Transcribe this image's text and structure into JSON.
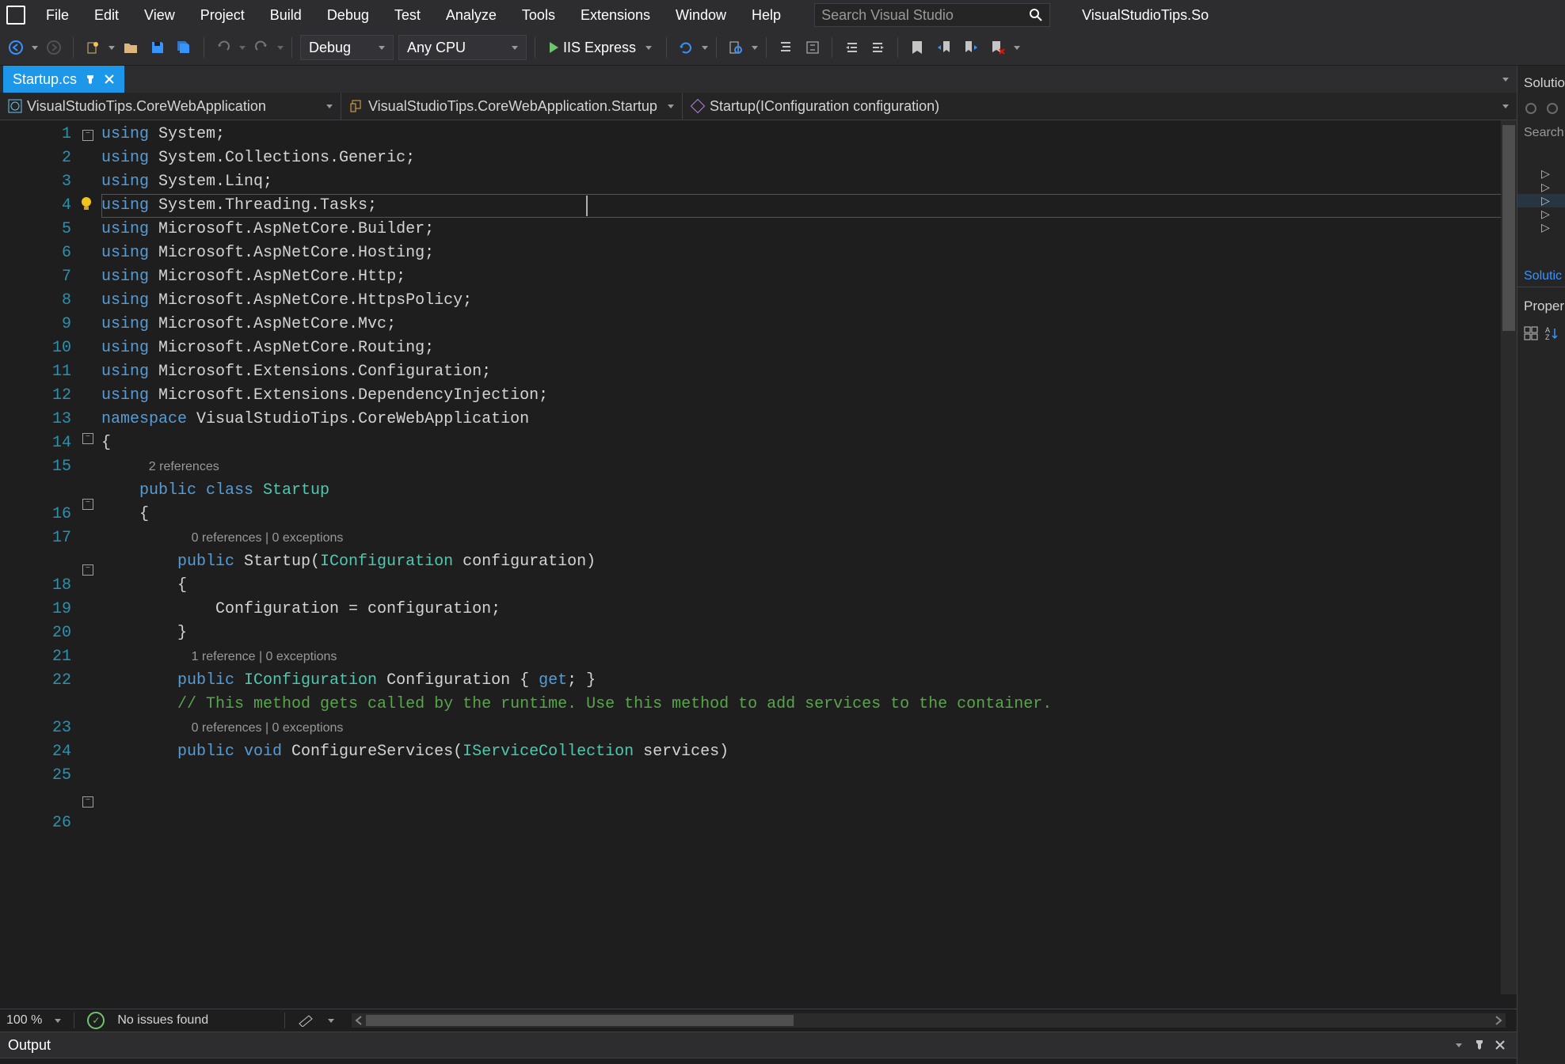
{
  "menu": {
    "items": [
      "File",
      "Edit",
      "View",
      "Project",
      "Build",
      "Debug",
      "Test",
      "Analyze",
      "Tools",
      "Extensions",
      "Window",
      "Help"
    ]
  },
  "search_placeholder": "Search Visual Studio",
  "solution_name": "VisualStudioTips.So",
  "toolbar": {
    "config": "Debug",
    "platform": "Any CPU",
    "run": "IIS Express"
  },
  "tab": {
    "name": "Startup.cs"
  },
  "nav": {
    "project": "VisualStudioTips.CoreWebApplication",
    "type": "VisualStudioTips.CoreWebApplication.Startup",
    "member": "Startup(IConfiguration configuration)"
  },
  "code": {
    "lines": [
      {
        "n": 1,
        "t": [
          [
            "kw",
            "using "
          ],
          [
            "ns",
            "System;"
          ]
        ]
      },
      {
        "n": 2,
        "t": [
          [
            "kw",
            "using "
          ],
          [
            "ns",
            "System.Collections.Generic;"
          ]
        ]
      },
      {
        "n": 3,
        "t": [
          [
            "kw",
            "using "
          ],
          [
            "ns",
            "System.Linq;"
          ]
        ]
      },
      {
        "n": 4,
        "t": [
          [
            "kw",
            "using "
          ],
          [
            "ns",
            "System.Threading.Tasks;"
          ]
        ]
      },
      {
        "n": 5,
        "t": [
          [
            "kw",
            "using "
          ],
          [
            "ns",
            "Microsoft.AspNetCore.Builder;"
          ]
        ]
      },
      {
        "n": 6,
        "t": [
          [
            "kw",
            "using "
          ],
          [
            "ns",
            "Microsoft.AspNetCore.Hosting;"
          ]
        ]
      },
      {
        "n": 7,
        "t": [
          [
            "kw",
            "using "
          ],
          [
            "ns",
            "Microsoft.AspNetCore.Http;"
          ]
        ]
      },
      {
        "n": 8,
        "t": [
          [
            "kw",
            "using "
          ],
          [
            "ns",
            "Microsoft.AspNetCore.HttpsPolicy;"
          ]
        ]
      },
      {
        "n": 9,
        "t": [
          [
            "kw",
            "using "
          ],
          [
            "ns",
            "Microsoft.AspNetCore.Mvc;"
          ]
        ]
      },
      {
        "n": 10,
        "t": [
          [
            "kw",
            "using "
          ],
          [
            "ns",
            "Microsoft.AspNetCore.Routing;"
          ]
        ]
      },
      {
        "n": 11,
        "t": [
          [
            "kw",
            "using "
          ],
          [
            "ns",
            "Microsoft.Extensions.Configuration;"
          ]
        ]
      },
      {
        "n": 12,
        "t": [
          [
            "kw",
            "using "
          ],
          [
            "ns",
            "Microsoft.Extensions.DependencyInjection;"
          ]
        ]
      },
      {
        "n": 13,
        "t": []
      },
      {
        "n": 14,
        "t": [
          [
            "kw",
            "namespace "
          ],
          [
            "ns",
            "VisualStudioTips.CoreWebApplication"
          ]
        ]
      },
      {
        "n": 15,
        "t": [
          [
            "ns",
            "{"
          ]
        ]
      },
      {
        "codelens": "2 references"
      },
      {
        "n": 16,
        "t": [
          [
            "ns",
            "    "
          ],
          [
            "kw",
            "public class "
          ],
          [
            "cls",
            "Startup"
          ]
        ]
      },
      {
        "n": 17,
        "t": [
          [
            "ns",
            "    {"
          ]
        ]
      },
      {
        "codelens": "0 references | 0 exceptions"
      },
      {
        "n": 18,
        "t": [
          [
            "ns",
            "        "
          ],
          [
            "kw",
            "public "
          ],
          [
            "ns",
            "Startup("
          ],
          [
            "cls",
            "IConfiguration"
          ],
          [
            "ns",
            " configuration)"
          ]
        ]
      },
      {
        "n": 19,
        "t": [
          [
            "ns",
            "        {"
          ]
        ]
      },
      {
        "n": 20,
        "t": [
          [
            "ns",
            "            Configuration = configuration;"
          ]
        ]
      },
      {
        "n": 21,
        "t": [
          [
            "ns",
            "        }"
          ]
        ]
      },
      {
        "n": 22,
        "t": []
      },
      {
        "codelens": "1 reference | 0 exceptions"
      },
      {
        "n": 23,
        "t": [
          [
            "ns",
            "        "
          ],
          [
            "kw",
            "public "
          ],
          [
            "cls",
            "IConfiguration"
          ],
          [
            "ns",
            " Configuration { "
          ],
          [
            "kw",
            "get"
          ],
          [
            "ns",
            "; }"
          ]
        ]
      },
      {
        "n": 24,
        "t": []
      },
      {
        "n": 25,
        "t": [
          [
            "ns",
            "        "
          ],
          [
            "cmt",
            "// This method gets called by the runtime. Use this method to add services to the container."
          ]
        ]
      },
      {
        "codelens": "0 references | 0 exceptions"
      },
      {
        "n": 26,
        "t": [
          [
            "ns",
            "        "
          ],
          [
            "kw",
            "public void "
          ],
          [
            "ns",
            "ConfigureServices("
          ],
          [
            "cls",
            "IServiceCollection"
          ],
          [
            "ns",
            " services)"
          ]
        ]
      }
    ]
  },
  "status": {
    "zoom": "100 %",
    "issues": "No issues found"
  },
  "output": {
    "title": "Output"
  },
  "side": {
    "title": "Solutio",
    "search": "Search",
    "link1": "Solutic",
    "link2": "Proper"
  }
}
